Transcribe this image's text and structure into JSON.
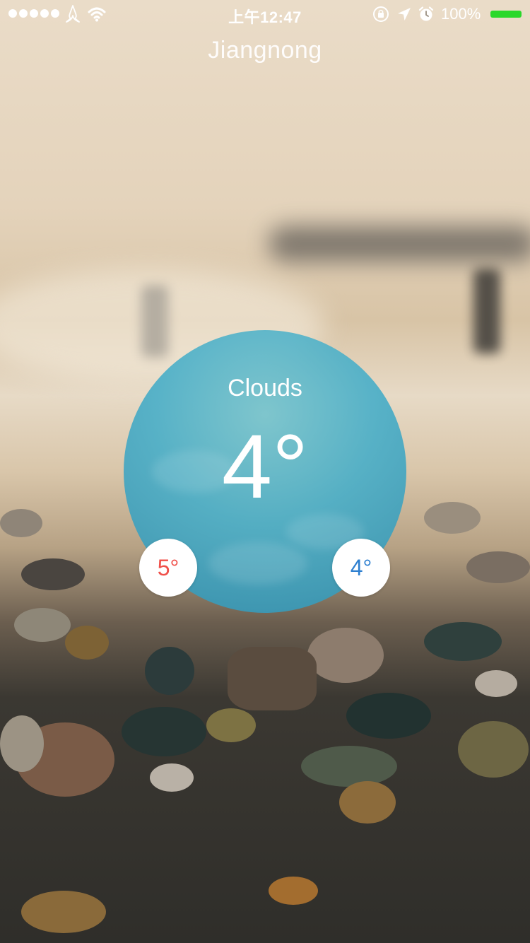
{
  "status_bar": {
    "time": "上午12:47",
    "battery_percent": "100%",
    "signal_bars": 5,
    "icons": [
      "signal-dots-icon",
      "carrier-icon",
      "wifi-icon",
      "rotation-lock-icon",
      "location-arrow-icon",
      "alarm-icon",
      "battery-icon"
    ],
    "battery_color": "#2ad82a"
  },
  "location": {
    "city": "Jiangnong"
  },
  "weather": {
    "condition": "Clouds",
    "temperature": "4°",
    "high": "5°",
    "low": "4°",
    "colors": {
      "circle": "#48aec8",
      "high": "#f0504a",
      "low": "#2d7fd0"
    }
  }
}
